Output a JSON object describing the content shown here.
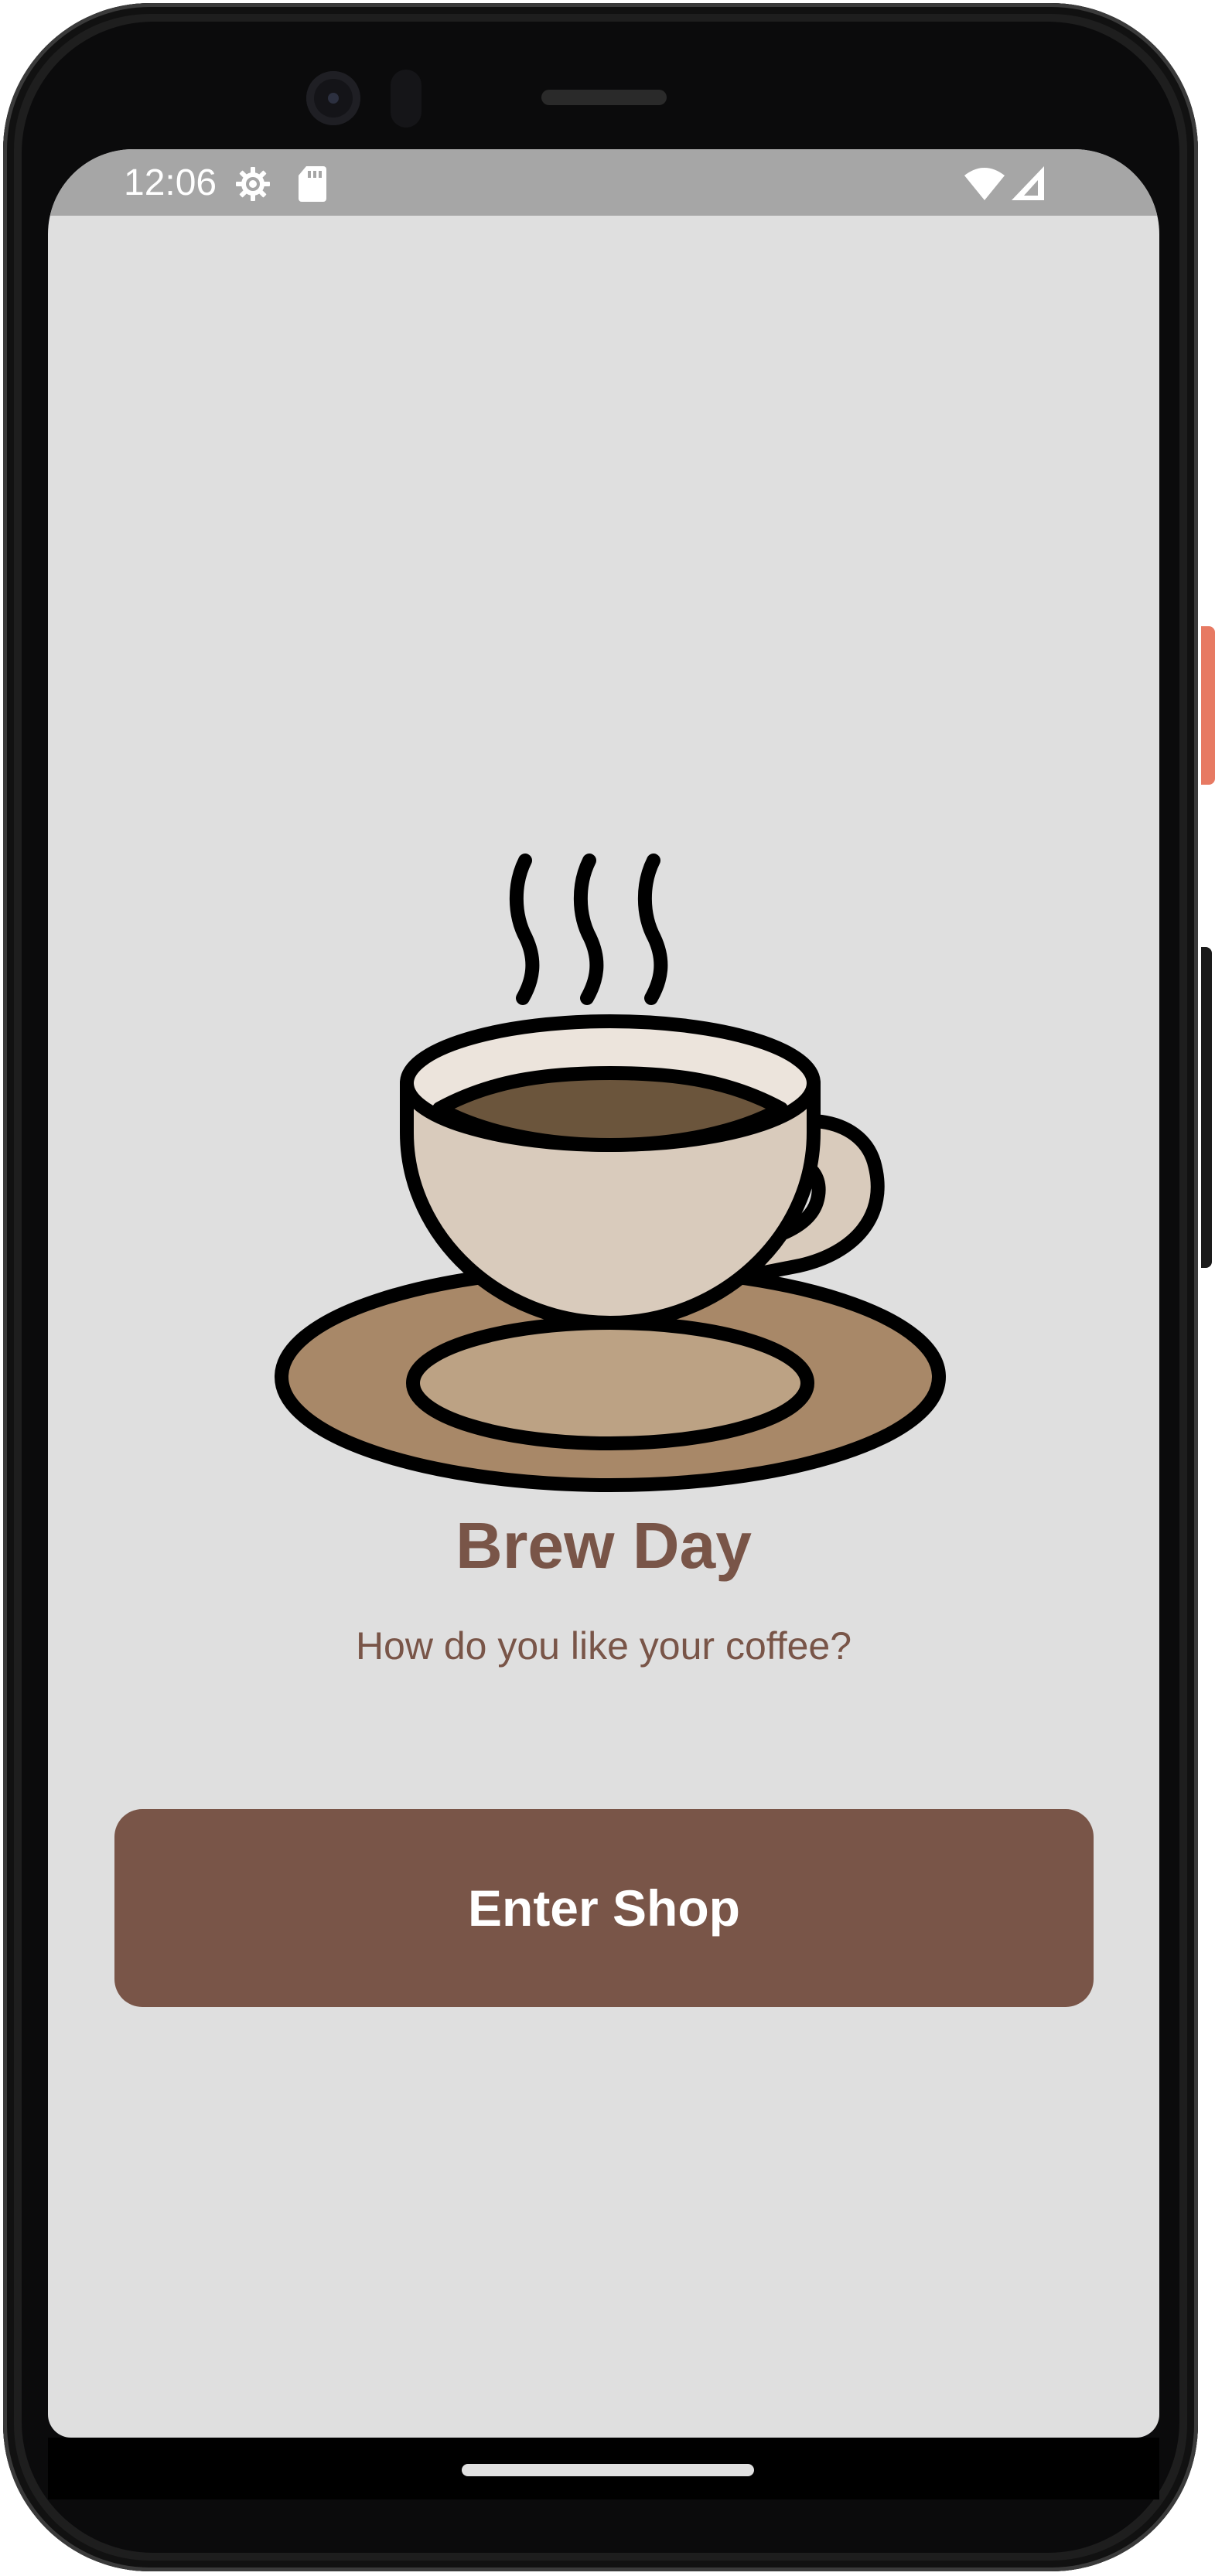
{
  "status_bar": {
    "time": "12:06",
    "icons": [
      "settings-gear-icon",
      "sd-card-icon",
      "wifi-icon",
      "cell-signal-icon"
    ]
  },
  "main": {
    "illustration": "coffee-cup-icon",
    "title": "Brew Day",
    "subtitle": "How do you like your coffee?",
    "enter_button_label": "Enter Shop"
  },
  "colors": {
    "accent": "#795548",
    "background": "#dfdfdf",
    "status_bar": "#a6a6a6",
    "saucer": "#a88868",
    "saucer_inner": "#bca284",
    "cup": "#d9cbbc",
    "cup_rim": "#ece4dc",
    "coffee": "#6b553c"
  }
}
